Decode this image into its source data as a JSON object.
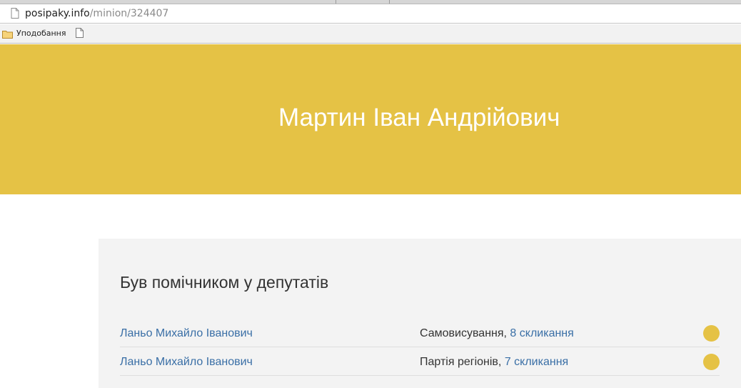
{
  "browser": {
    "url_domain": "posipaky.info",
    "url_path": "/minion/324407",
    "bookmarks_folder_label": "Уподобання"
  },
  "hero": {
    "title": "Мартин Іван Андрійович",
    "background_color": "#e5c245"
  },
  "assistant_of": {
    "heading": "Був помічником у депутатів",
    "rows": [
      {
        "deputy": "Ланьо Михайло Іванович",
        "party": "Самовисування",
        "separator": ", ",
        "convocation": "8 скликання",
        "marker_color": "#e5c245"
      },
      {
        "deputy": "Ланьо Михайло Іванович",
        "party": "Партія регіонів",
        "separator": ", ",
        "convocation": "7 скликання",
        "marker_color": "#e5c245"
      }
    ]
  },
  "icons": {
    "address_page": "page-icon",
    "bookmarks_folder": "folder-icon",
    "bookmark_page": "document-icon"
  }
}
